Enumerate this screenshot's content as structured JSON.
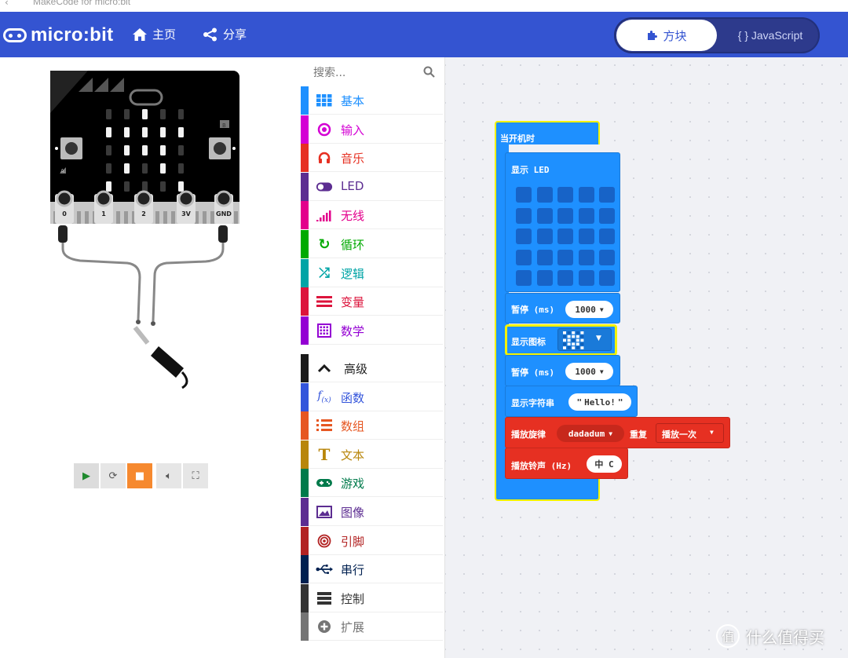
{
  "window": {
    "back_glyph": "‹",
    "title": "MakeCode for micro:bit"
  },
  "header": {
    "logo_text": "micro:bit",
    "home_label": "主页",
    "share_label": "分享",
    "blocks_tab": "方块",
    "js_tab": "{ } JavaScript"
  },
  "simulator": {
    "pins": [
      "0",
      "1",
      "2",
      "3V",
      "GND"
    ],
    "button_a": "A",
    "button_b": "B",
    "led_pattern": [
      [
        0,
        0,
        1,
        0,
        0
      ],
      [
        1,
        1,
        1,
        1,
        1
      ],
      [
        0,
        1,
        1,
        1,
        0
      ],
      [
        0,
        1,
        0,
        1,
        0
      ],
      [
        1,
        0,
        0,
        0,
        1
      ]
    ],
    "controls": [
      "play",
      "restart",
      "screenshot",
      "mute",
      "fullscreen"
    ]
  },
  "toolbox": {
    "search_placeholder": "搜索...",
    "categories": [
      {
        "label": "基本",
        "color": "#1e90ff",
        "icon": "grid-icon"
      },
      {
        "label": "输入",
        "color": "#d400d4",
        "icon": "target-icon"
      },
      {
        "label": "音乐",
        "color": "#e63022",
        "icon": "headphones-icon"
      },
      {
        "label": "LED",
        "color": "#5c2d91",
        "icon": "toggle-icon"
      },
      {
        "label": "无线",
        "color": "#e3008c",
        "icon": "signal-bars-icon"
      },
      {
        "label": "循环",
        "color": "#00aa00",
        "icon": "refresh-icon"
      },
      {
        "label": "逻辑",
        "color": "#00a4a6",
        "icon": "shuffle-icon"
      },
      {
        "label": "变量",
        "color": "#dc143c",
        "icon": "list-lines-icon"
      },
      {
        "label": "数学",
        "color": "#9400d3",
        "icon": "calculator-icon"
      },
      {
        "label": "高级",
        "color": "#1a1a1a",
        "icon": "chevron-up-icon"
      },
      {
        "label": "函数",
        "color": "#3455db",
        "icon": "function-icon"
      },
      {
        "label": "数组",
        "color": "#e65722",
        "icon": "ordered-list-icon"
      },
      {
        "label": "文本",
        "color": "#b8860b",
        "icon": "text-t-icon"
      },
      {
        "label": "游戏",
        "color": "#007a4b",
        "icon": "gamepad-icon"
      },
      {
        "label": "图像",
        "color": "#5c2d91",
        "icon": "image-icon"
      },
      {
        "label": "引脚",
        "color": "#b22222",
        "icon": "bullseye-icon"
      },
      {
        "label": "串行",
        "color": "#002050",
        "icon": "usb-icon"
      },
      {
        "label": "控制",
        "color": "#333333",
        "icon": "server-icon"
      },
      {
        "label": "扩展",
        "color": "#757575",
        "icon": "plus-circle-icon"
      }
    ]
  },
  "workspace": {
    "on_start": "当开机时",
    "show_leds": "显示 LED",
    "pause1": {
      "label": "暂停 (ms)",
      "value": "1000"
    },
    "show_icon": "显示图标",
    "pause2": {
      "label": "暂停 (ms)",
      "value": "1000"
    },
    "show_string": {
      "label": "显示字符串",
      "value": "Hello!"
    },
    "play_melody": {
      "label": "播放旋律",
      "melody": "dadadum",
      "repeat_label": "重复",
      "repeat_value": "播放一次"
    },
    "play_tone": {
      "label": "播放铃声 (Hz)",
      "value": "中 C"
    },
    "icon_pattern": [
      [
        1,
        0,
        1,
        0,
        1
      ],
      [
        0,
        1,
        1,
        1,
        0
      ],
      [
        1,
        1,
        0,
        1,
        1
      ],
      [
        0,
        1,
        1,
        1,
        0
      ],
      [
        1,
        0,
        1,
        0,
        1
      ]
    ]
  },
  "watermark": {
    "glyph": "值",
    "text": "什么值得买"
  }
}
